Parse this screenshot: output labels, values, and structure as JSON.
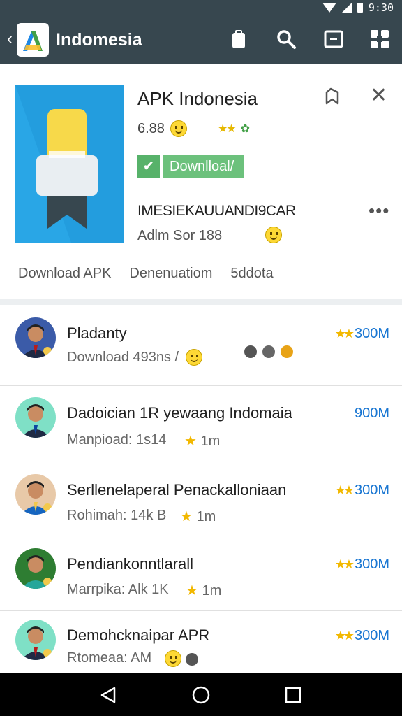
{
  "status_bar": {
    "time": "9:30"
  },
  "app_bar": {
    "back_glyph": "‹",
    "title": "Indomesia",
    "actions": [
      "clipboard-icon",
      "search-icon",
      "window-icon",
      "grid-icon"
    ]
  },
  "detail": {
    "app_name": "APK Indonesia",
    "rating_text": "6.88",
    "download_label": "Downlloal/",
    "developer": "IMESIEKAUUANDI9CAR",
    "meta": "Adlm Sor 188",
    "more_glyph": "•••",
    "close_glyph": "✕",
    "tabs": [
      "Download APK",
      "Denenuatiom",
      "5ddota"
    ]
  },
  "list": [
    {
      "title": "Pladanty",
      "subtitle": "Download 493ns /",
      "stars": "★★",
      "count": "300M"
    },
    {
      "title": "Dadoician 1R yewaang Indomaia",
      "subtitle": "Manpioad: 1s14",
      "sub_tail": "1m",
      "stars": "",
      "count": "900M"
    },
    {
      "title": "Serllenelaperal Penackalloniaan",
      "subtitle": "Rohimah: 14k B",
      "sub_tail": "1m",
      "stars": "★★",
      "count": "300M"
    },
    {
      "title": "Pendiankonntlarall",
      "subtitle": "Marrpika: Alk 1K",
      "sub_tail": "1m",
      "stars": "★★",
      "count": "300M"
    },
    {
      "title": "Demohcknaipar APR",
      "subtitle": "Rtomeaa: AM",
      "stars": "★★",
      "count": "300M"
    }
  ],
  "colors": {
    "app_bar": "#37474f",
    "accent_green": "#6cc17c",
    "count_blue": "#1976d2",
    "star_gold": "#f2b800"
  }
}
